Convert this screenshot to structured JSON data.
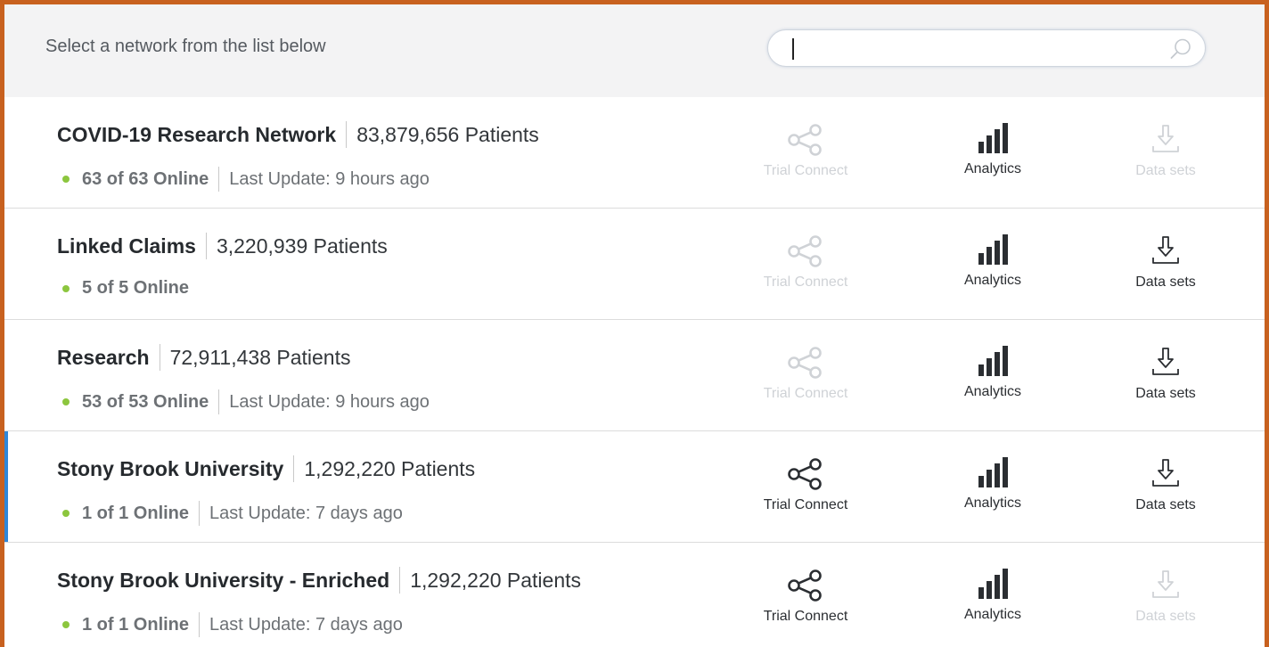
{
  "header": {
    "instruction": "Select a network from the list below",
    "search_value": "",
    "search_placeholder": ""
  },
  "colors": {
    "frame_border": "#c8611f",
    "selected_accent": "#2f87d9",
    "online_dot": "#8cc63e",
    "disabled": "#cfd2d6"
  },
  "actions_labels": {
    "trial": "Trial Connect",
    "analytics": "Analytics",
    "datasets": "Data sets"
  },
  "icons": {
    "trial": "share-icon",
    "analytics": "bar-chart-icon",
    "datasets": "download-icon",
    "search": "search-icon"
  },
  "networks": [
    {
      "name": "COVID-19 Research Network",
      "patients": "83,879,656 Patients",
      "online": "63 of 63 Online",
      "last_update": "Last Update: 9 hours ago",
      "trial_enabled": false,
      "analytics_enabled": true,
      "datasets_enabled": false,
      "selected": false
    },
    {
      "name": "Linked Claims",
      "patients": "3,220,939 Patients",
      "online": "5 of 5 Online",
      "last_update": "",
      "trial_enabled": false,
      "analytics_enabled": true,
      "datasets_enabled": true,
      "selected": false
    },
    {
      "name": "Research",
      "patients": "72,911,438 Patients",
      "online": "53 of 53 Online",
      "last_update": "Last Update: 9 hours ago",
      "trial_enabled": false,
      "analytics_enabled": true,
      "datasets_enabled": true,
      "selected": false
    },
    {
      "name": "Stony Brook University",
      "patients": "1,292,220 Patients",
      "online": "1 of 1 Online",
      "last_update": "Last Update: 7 days ago",
      "trial_enabled": true,
      "analytics_enabled": true,
      "datasets_enabled": true,
      "selected": true
    },
    {
      "name": "Stony Brook University - Enriched",
      "patients": "1,292,220 Patients",
      "online": "1 of 1 Online",
      "last_update": "Last Update: 7 days ago",
      "trial_enabled": true,
      "analytics_enabled": true,
      "datasets_enabled": false,
      "selected": false
    }
  ]
}
